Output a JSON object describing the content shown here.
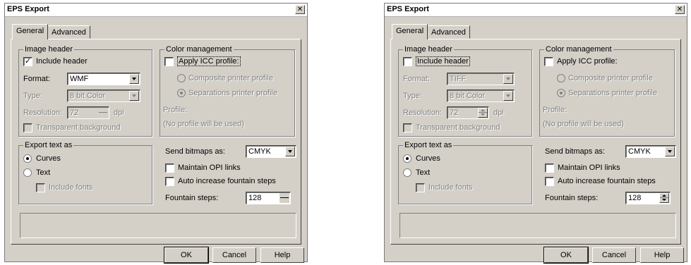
{
  "dialogs": [
    {
      "title": "EPS Export",
      "close_glyph": "✕",
      "tabs": [
        "General",
        "Advanced"
      ],
      "image_header": {
        "legend": "Image header",
        "include_header": {
          "label": "Include header",
          "checked": true
        },
        "format": {
          "label": "Format:",
          "value": "WMF"
        },
        "type": {
          "label": "Type:",
          "value": "8 bit Color"
        },
        "resolution": {
          "label": "Resolution:",
          "value": "72",
          "unit": "dpi"
        },
        "transparent": {
          "label": "Transparent background"
        }
      },
      "color_management": {
        "legend": "Color management",
        "apply_icc": {
          "label": "Apply ICC profile:"
        },
        "composite": "Composite printer profile",
        "separations": "Separations printer profile",
        "profile_label": "Profile:",
        "profile_value": "(No profile will be used)"
      },
      "export_text": {
        "legend": "Export text as",
        "curves": "Curves",
        "text": "Text",
        "include_fonts": "Include fonts"
      },
      "send_bitmaps": {
        "label": "Send bitmaps as:",
        "value": "CMYK"
      },
      "maintain_opi": "Maintain OPI links",
      "auto_increase": "Auto increase fountain steps",
      "fountain_steps": {
        "label": "Fountain steps:",
        "value": "128"
      },
      "buttons": {
        "ok": "OK",
        "cancel": "Cancel",
        "help": "Help"
      }
    },
    {
      "title": "EPS Export",
      "close_glyph": "✕",
      "tabs": [
        "General",
        "Advanced"
      ],
      "image_header": {
        "legend": "Image header",
        "include_header": {
          "label": "Include header",
          "checked": false
        },
        "format": {
          "label": "Format:",
          "value": "TIFF"
        },
        "type": {
          "label": "Type:",
          "value": "8 bit Color"
        },
        "resolution": {
          "label": "Resolution:",
          "value": "72",
          "unit": "dpi"
        },
        "transparent": {
          "label": "Transparent background"
        }
      },
      "color_management": {
        "legend": "Color management",
        "apply_icc": {
          "label": "Apply ICC profile:"
        },
        "composite": "Composite printer profile",
        "separations": "Separations printer profile",
        "profile_label": "Profile:",
        "profile_value": "(No profile will be used)"
      },
      "export_text": {
        "legend": "Export text as",
        "curves": "Curves",
        "text": "Text",
        "include_fonts": "Include fonts"
      },
      "send_bitmaps": {
        "label": "Send bitmaps as:",
        "value": "CMYK"
      },
      "maintain_opi": "Maintain OPI links",
      "auto_increase": "Auto increase fountain steps",
      "fountain_steps": {
        "label": "Fountain steps:",
        "value": "128"
      },
      "buttons": {
        "ok": "OK",
        "cancel": "Cancel",
        "help": "Help"
      }
    }
  ]
}
